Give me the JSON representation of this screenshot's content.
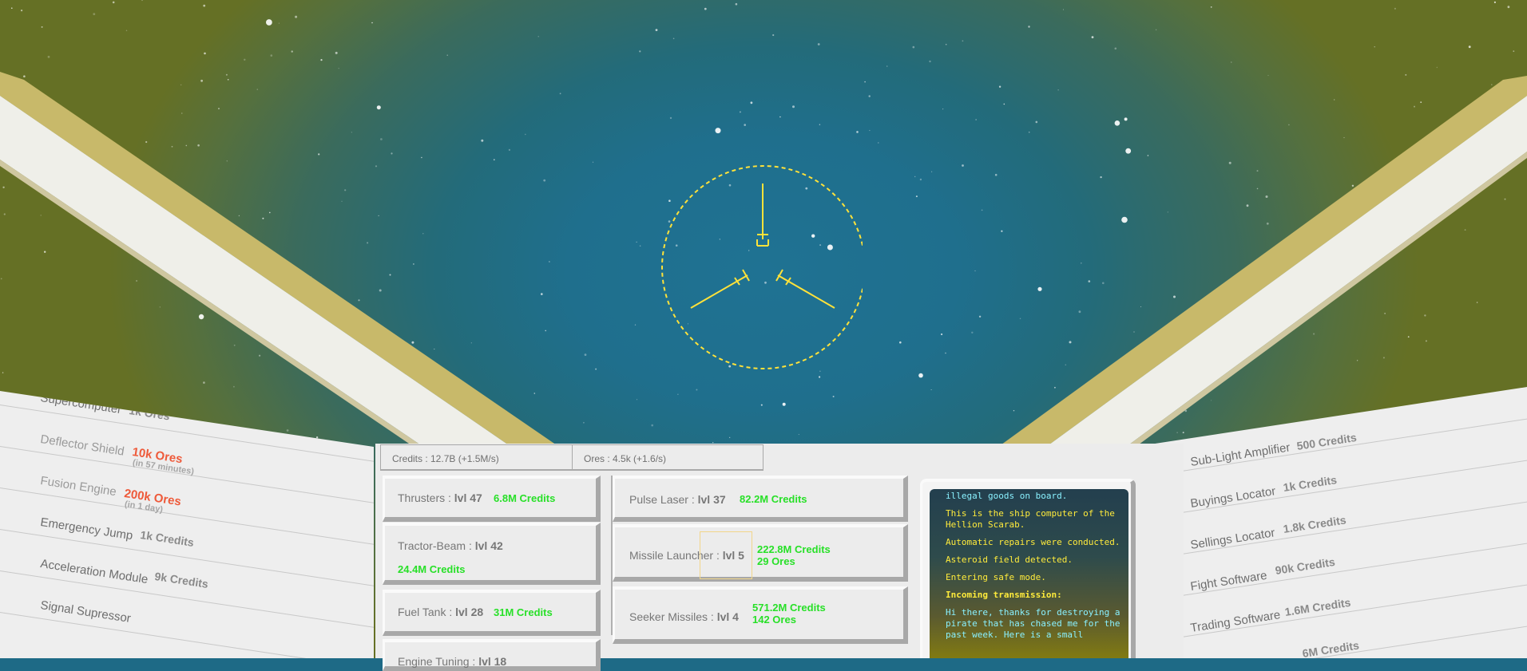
{
  "colors": {
    "accent_yellow": "#ffe23a",
    "credits_green": "#28e028",
    "ores_red": "#ee5a3a",
    "beam_gold": "#c8b96a"
  },
  "resources": {
    "credits": "Credits : 12.7B (+1.5M/s)",
    "ores": "Ores : 4.5k (+1.6/s)"
  },
  "left_upgrades": [
    {
      "name": "Supercomputer",
      "cost": "1k Ores",
      "dim": false
    },
    {
      "name": "Deflector Shield",
      "cost": "10k Ores",
      "sub": "(in 57 minutes)",
      "dim": true
    },
    {
      "name": "Fusion Engine",
      "cost": "200k Ores",
      "sub": "(in 1 day)",
      "dim": true
    },
    {
      "name": "Emergency Jump",
      "cost": "1k Credits",
      "dim": false
    },
    {
      "name": "Acceleration Module",
      "cost": "9k Credits",
      "dim": false
    },
    {
      "name": "Signal Supressor",
      "cost": "",
      "dim": false
    }
  ],
  "right_upgrades": [
    {
      "name": "Sub-Light Amplifier",
      "cost": "500 Credits"
    },
    {
      "name": "Buyings Locator",
      "cost": "1k Credits"
    },
    {
      "name": "Sellings Locator",
      "cost": "1.8k Credits"
    },
    {
      "name": "Fight Software",
      "cost": "90k Credits"
    },
    {
      "name": "Trading Software",
      "cost": "1.6M Credits"
    },
    {
      "name": "",
      "cost": "6M Credits"
    }
  ],
  "ship_modules": [
    {
      "name": "Thrusters : ",
      "level": "lvl 47",
      "cost": "6.8M Credits"
    },
    {
      "name": "Tractor-Beam : ",
      "level": "lvl 42",
      "cost": "24.4M Credits"
    },
    {
      "name": "Fuel Tank : ",
      "level": "lvl 28",
      "cost": "31M Credits"
    },
    {
      "name": "Engine Tuning : ",
      "level": "lvl 18",
      "cost": ""
    }
  ],
  "weapons": [
    {
      "name": "Pulse Laser : ",
      "level": "lvl 37",
      "cost": "82.2M Credits",
      "ores": ""
    },
    {
      "name": "Missile Launcher : ",
      "level": "lvl 5",
      "cost": "222.8M Credits",
      "ores": "29 Ores"
    },
    {
      "name": "Seeker Missiles : ",
      "level": "lvl 4",
      "cost": "571.2M Credits",
      "ores": "142 Ores"
    }
  ],
  "log": [
    {
      "text": "illegal goods on board.",
      "style": "cyan"
    },
    {
      "text": "This is the ship computer of the Hellion Scarab.",
      "style": ""
    },
    {
      "text": "Automatic repairs were conducted.",
      "style": ""
    },
    {
      "text": "Asteroid field detected.",
      "style": ""
    },
    {
      "text": "Entering safe mode.",
      "style": ""
    },
    {
      "text": "Incoming transmission:",
      "style": "bold"
    },
    {
      "text": "Hi there, thanks for destroying a pirate that has chased me for the past week. Here is a small",
      "style": "cyan"
    }
  ]
}
